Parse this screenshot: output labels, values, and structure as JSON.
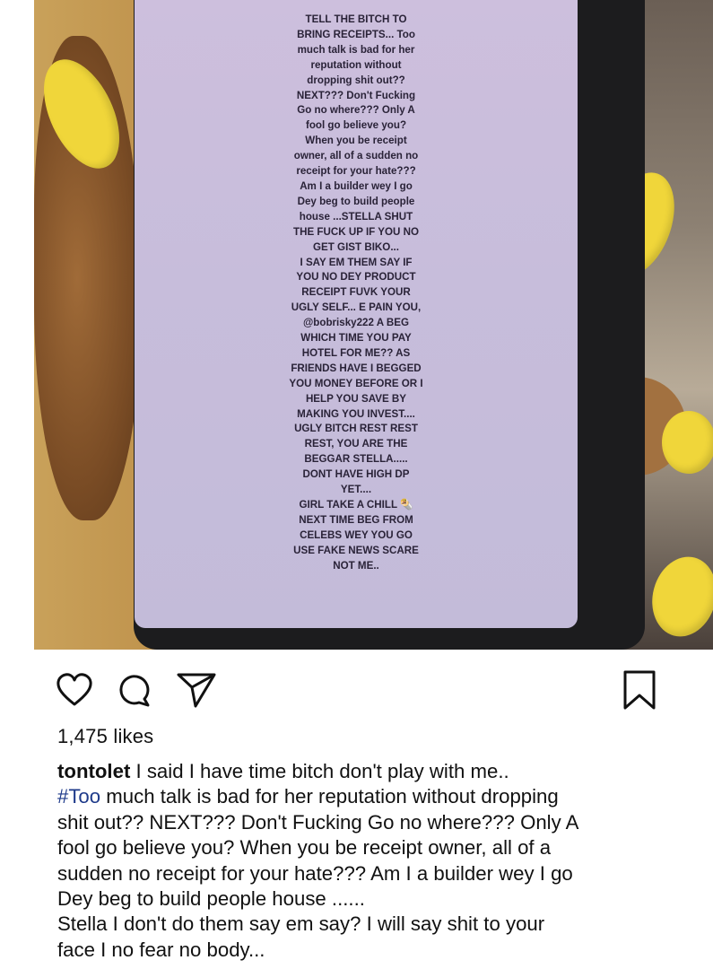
{
  "story": {
    "lines": [
      "TELL THE BITCH TO",
      "BRING RECEIPTS... Too",
      "much talk is bad for her",
      "reputation without",
      "dropping shit out??",
      "NEXT??? Don't Fucking",
      "Go no where??? Only A",
      "fool go believe you?",
      "When you be receipt",
      "owner, all of a sudden no",
      "receipt for your hate???",
      "Am I a builder wey I go",
      "Dey beg to build people",
      "house ...STELLA SHUT",
      "THE FUCK UP IF YOU NO",
      "GET GIST BIKO...",
      "I SAY EM THEM SAY IF",
      "YOU NO DEY PRODUCT",
      "RECEIPT FUVK YOUR",
      "UGLY SELF... E PAIN YOU,",
      "@bobrisky222 A BEG",
      "WHICH TIME YOU PAY",
      "HOTEL FOR ME?? AS",
      "FRIENDS HAVE I BEGGED",
      "YOU MONEY BEFORE OR I",
      "HELP YOU SAVE BY",
      "MAKING YOU INVEST....",
      "UGLY BITCH REST REST",
      "REST, YOU ARE THE",
      "BEGGAR STELLA.....",
      "DONT HAVE HIGH DP",
      "YET....",
      "GIRL TAKE A CHILL 🌯",
      "NEXT TIME BEG FROM",
      "CELEBS WEY YOU GO",
      "USE FAKE NEWS SCARE",
      "NOT ME.."
    ]
  },
  "actions": {
    "like_icon": "heart-icon",
    "comment_icon": "comment-icon",
    "share_icon": "send-icon",
    "save_icon": "bookmark-icon"
  },
  "likes": "1,475 likes",
  "caption": {
    "username": "tontolet",
    "line1_text": " I said I have time bitch don't play with me..",
    "hashtag": "#Too",
    "line2_text": " much talk is bad for her reputation without dropping",
    "line3": "shit out?? NEXT??? Don't Fucking Go no where??? Only A",
    "line4": "fool go believe you? When you be receipt owner, all of a",
    "line5": "sudden no receipt for your hate??? Am I a builder wey I go",
    "line6": "Dey beg to build people house ......",
    "line7": "Stella I don't do them say em say? I will say shit to your",
    "line8": "face I no fear no body..."
  },
  "colors": {
    "hashtag": "#1e3a8a",
    "screen": "#c7bddb",
    "nail": "#f0d63a"
  }
}
